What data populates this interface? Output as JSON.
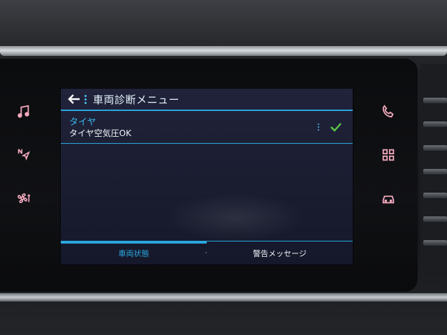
{
  "header": {
    "title": "車両診断メニュー"
  },
  "diagnostics": {
    "items": [
      {
        "title": "タイヤ",
        "status": "タイヤ空気圧OK",
        "state": "ok"
      }
    ]
  },
  "tabs": [
    {
      "label": "車両状態",
      "active": true
    },
    {
      "label": "警告メッセージ",
      "active": false
    }
  ],
  "side_buttons": {
    "left": [
      "music-icon",
      "navigation-icon",
      "climate-fan-icon"
    ],
    "right": [
      "phone-icon",
      "apps-grid-icon",
      "car-icon"
    ]
  },
  "colors": {
    "accent": "#2aa7e0",
    "check": "#5cc84a",
    "button_glow": "#f2a9bd"
  }
}
